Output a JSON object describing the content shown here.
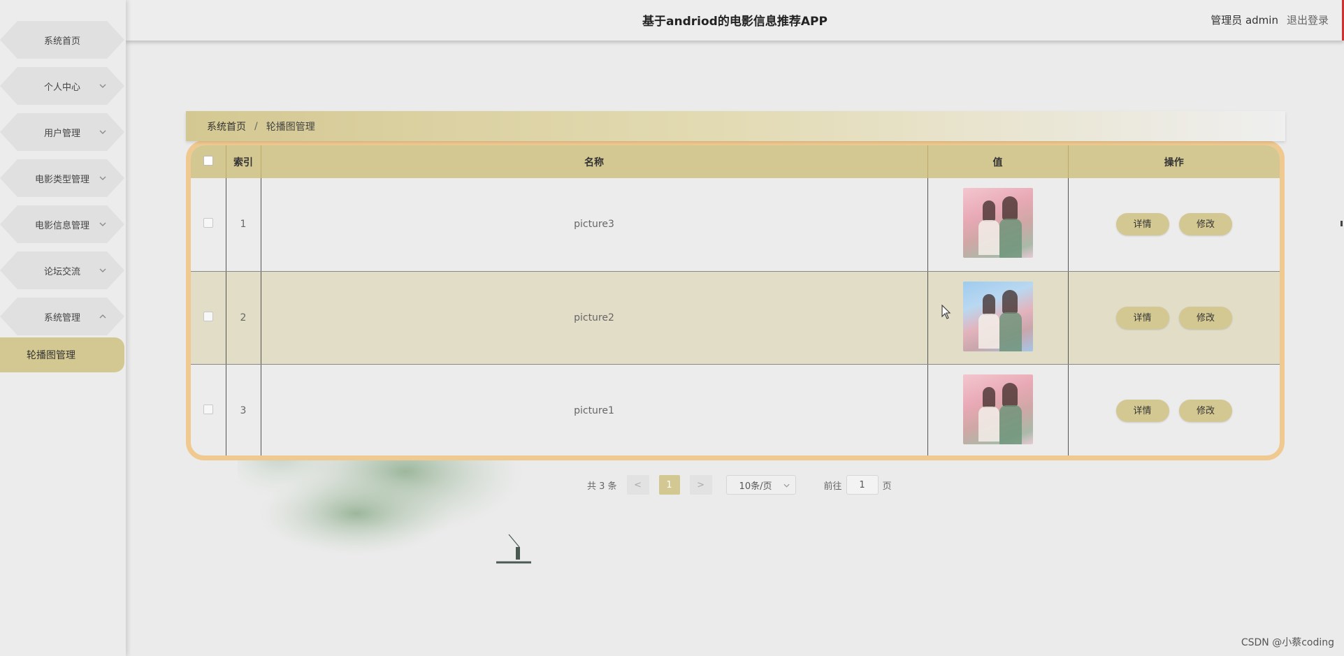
{
  "app": {
    "title": "基于andriod的电影信息推荐APP",
    "admin_label": "管理员 admin",
    "logout_label": "退出登录"
  },
  "sidebar": {
    "items": [
      {
        "label": "系统首页",
        "expandable": false
      },
      {
        "label": "个人中心",
        "expandable": true,
        "expanded": false
      },
      {
        "label": "用户管理",
        "expandable": true,
        "expanded": false
      },
      {
        "label": "电影类型管理",
        "expandable": true,
        "expanded": false
      },
      {
        "label": "电影信息管理",
        "expandable": true,
        "expanded": false
      },
      {
        "label": "论坛交流",
        "expandable": true,
        "expanded": false
      },
      {
        "label": "系统管理",
        "expandable": true,
        "expanded": true
      }
    ],
    "submenu": [
      {
        "label": "轮播图管理",
        "active": true
      }
    ]
  },
  "breadcrumb": {
    "home": "系统首页",
    "separator": "/",
    "current": "轮播图管理"
  },
  "table": {
    "headers": {
      "index": "索引",
      "name": "名称",
      "value": "值",
      "actions": "操作"
    },
    "rows": [
      {
        "index": "1",
        "name": "picture3",
        "thumb": "pink"
      },
      {
        "index": "2",
        "name": "picture2",
        "thumb": "blue"
      },
      {
        "index": "3",
        "name": "picture1",
        "thumb": "pink"
      }
    ],
    "detail_label": "详情",
    "edit_label": "修改"
  },
  "pagination": {
    "total": "共 3 条",
    "prev": "<",
    "current_page": "1",
    "next": ">",
    "page_size": "10条/页",
    "goto_label": "前往",
    "goto_value": "1",
    "page_unit": "页"
  },
  "watermark": "CSDN @小蔡coding",
  "colors": {
    "accent": "#d4c892",
    "table_border": "#f0c990",
    "striped_row": "#e2ddc7"
  }
}
